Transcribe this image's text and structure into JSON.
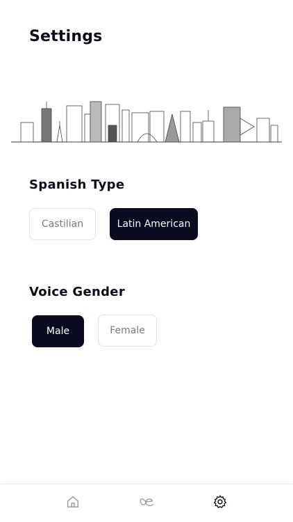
{
  "header": {
    "title": "Settings"
  },
  "illustration": {
    "icon": "city-skyline-illustration"
  },
  "spanish_type": {
    "title": "Spanish Type",
    "options": [
      {
        "label": "Castilian",
        "selected": false
      },
      {
        "label": "Latin American",
        "selected": true
      }
    ]
  },
  "voice_gender": {
    "title": "Voice Gender",
    "options": [
      {
        "label": "Male",
        "selected": true
      },
      {
        "label": "Female",
        "selected": false
      }
    ]
  },
  "tabbar": {
    "items": [
      {
        "icon": "home-icon",
        "active": false
      },
      {
        "icon": "ligature-ae-icon",
        "active": false
      },
      {
        "icon": "gear-icon",
        "active": true
      }
    ]
  },
  "colors": {
    "accent": "#0b0b1f",
    "inactive_icon": "#9a9aa4"
  }
}
